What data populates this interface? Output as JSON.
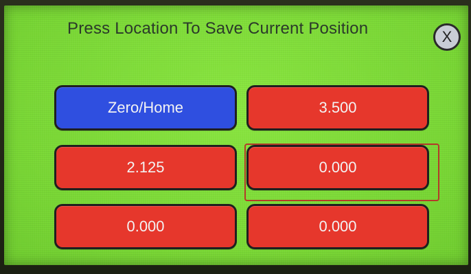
{
  "header": {
    "title": "Press Location To Save Current Position",
    "close_label": "X"
  },
  "buttons": {
    "zero_home": "Zero/Home",
    "slot_1": "3.500",
    "slot_2": "2.125",
    "slot_3": "0.000",
    "slot_4": "0.000",
    "slot_5": "0.000"
  },
  "colors": {
    "screen_background": "#7ee03a",
    "button_red": "#e6372c",
    "button_blue": "#2f4fe0",
    "selection_outline": "#b43a2a"
  },
  "icons": {
    "close": "close-icon"
  }
}
